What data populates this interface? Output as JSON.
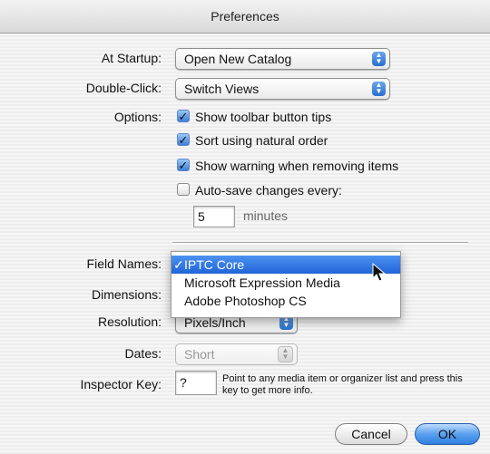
{
  "window": {
    "title": "Preferences"
  },
  "startup": {
    "label": "At Startup:",
    "value": "Open New Catalog"
  },
  "double_click": {
    "label": "Double-Click:",
    "value": "Switch Views"
  },
  "options": {
    "label": "Options:",
    "show_tips": {
      "label": "Show toolbar button tips",
      "checked": true
    },
    "natural_order": {
      "label": "Sort using natural order",
      "checked": true
    },
    "warning_removing": {
      "label": "Show warning when removing items",
      "checked": true
    },
    "autosave": {
      "label": "Auto-save changes every:",
      "checked": false,
      "value": "5",
      "unit": "minutes"
    }
  },
  "field_names": {
    "label": "Field Names:",
    "menu": [
      {
        "label": "IPTC Core",
        "selected": true,
        "check": "✓"
      },
      {
        "label": "Microsoft Expression Media",
        "selected": false
      },
      {
        "label": "Adobe Photoshop CS",
        "selected": false
      }
    ]
  },
  "dimensions": {
    "label": "Dimensions:"
  },
  "resolution": {
    "label": "Resolution:",
    "value": "Pixels/Inch"
  },
  "dates": {
    "label": "Dates:",
    "value": "Short"
  },
  "inspector_key": {
    "label": "Inspector Key:",
    "value": "?",
    "hint": "Point to any media item or organizer list and press this key to get more info."
  },
  "buttons": {
    "cancel": "Cancel",
    "ok": "OK"
  },
  "icons": {
    "stepper": "up-down-arrows-icon",
    "checkmark": "checkmark-icon",
    "cursor": "mouse-pointer-icon"
  },
  "colors": {
    "accent": "#2f7fe0",
    "selection": "#1f64d8"
  }
}
